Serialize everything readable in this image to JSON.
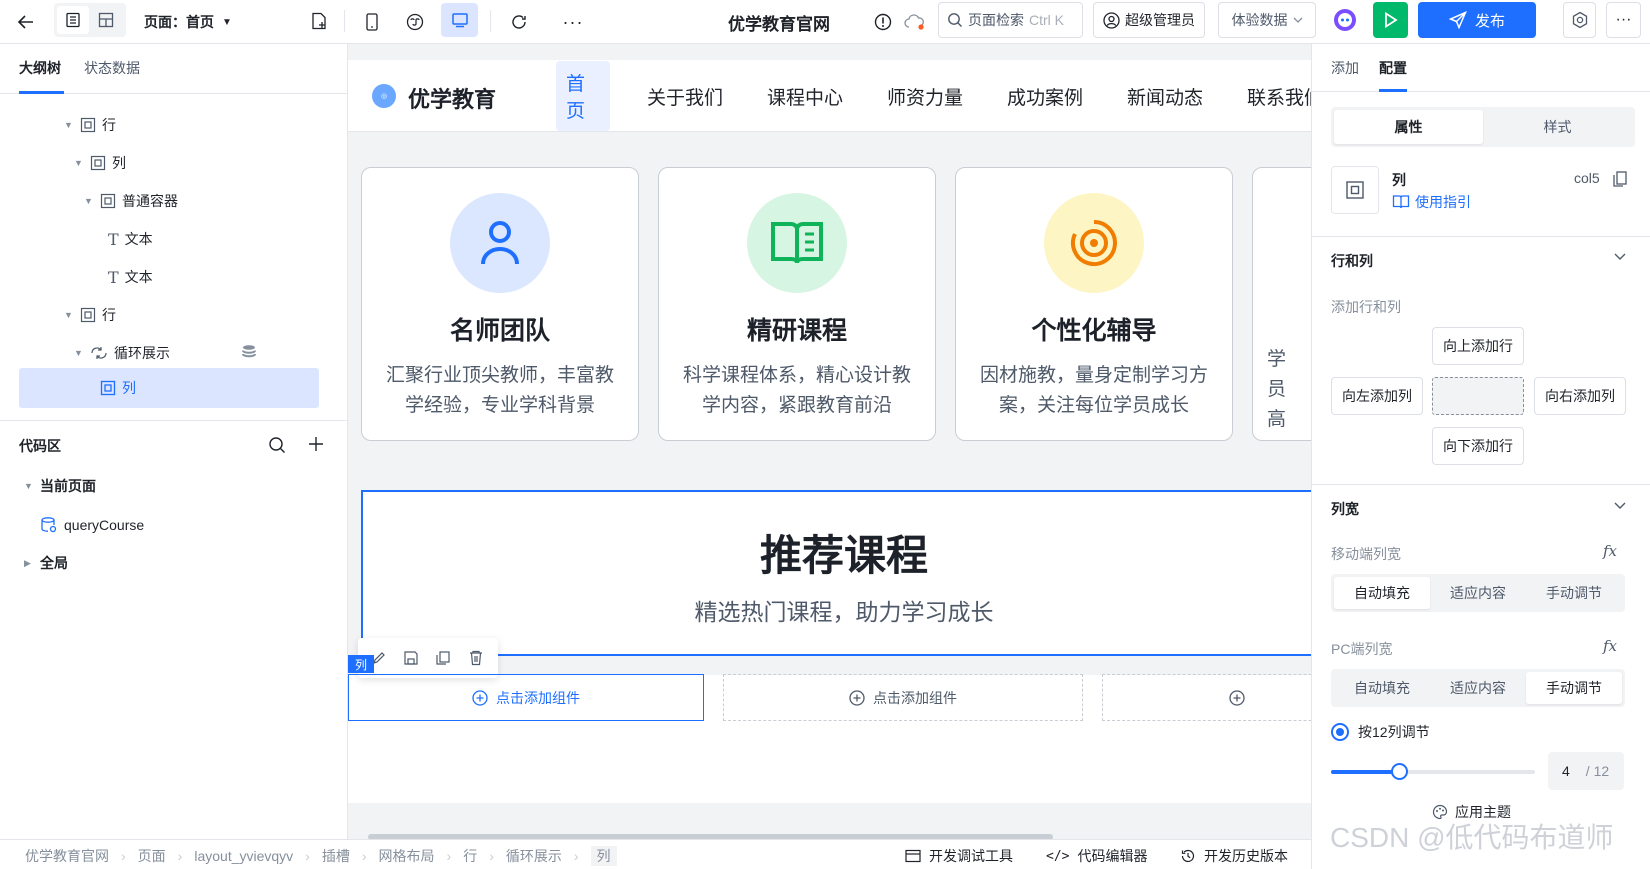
{
  "topbar": {
    "page_label": "页面：首页",
    "app_title": "优学教育官网",
    "search_placeholder": "页面检索",
    "search_shortcut": "Ctrl K",
    "user": "超级管理员",
    "data_select": "体验数据",
    "publish": "发布"
  },
  "left": {
    "tabs": [
      "大纲树",
      "状态数据"
    ],
    "tree": [
      "行",
      "列",
      "普通容器",
      "文本",
      "文本",
      "行",
      "循环展示",
      "列"
    ],
    "code_title": "代码区",
    "code_items": [
      "当前页面",
      "queryCourse",
      "全局"
    ]
  },
  "site": {
    "brand": "优学教育",
    "nav": [
      "首页",
      "关于我们",
      "课程中心",
      "师资力量",
      "成功案例",
      "新闻动态",
      "联系我们"
    ],
    "cards": [
      {
        "title": "名师团队",
        "desc": "汇聚行业顶尖教师，丰富教学经验，专业学科背景"
      },
      {
        "title": "精研课程",
        "desc": "科学课程体系，精心设计教学内容，紧跟教育前沿"
      },
      {
        "title": "个性化辅导",
        "desc": "因材施教，量身定制学习方案，关注每位学员成长"
      },
      {
        "title": "",
        "desc": "学员高"
      }
    ],
    "rec_title": "推荐课程",
    "rec_sub": "精选热门课程，助力学习成长",
    "col_tag": "列",
    "add_comp": "点击添加组件"
  },
  "right": {
    "tabs": [
      "添加",
      "配置"
    ],
    "seg1": [
      "属性",
      "样式"
    ],
    "comp_name": "列",
    "comp_id": "col5",
    "guide": "使用指引",
    "sec_rowcol": "行和列",
    "add_rowcol": "添加行和列",
    "btn_up": "向上添加行",
    "btn_left": "向左添加列",
    "btn_right": "向右添加列",
    "btn_down": "向下添加行",
    "sec_width": "列宽",
    "mobile_label": "移动端列宽",
    "pc_label": "PC端列宽",
    "width_opts": [
      "自动填充",
      "适应内容",
      "手动调节"
    ],
    "radio_label": "按12列调节",
    "slider_value": "4",
    "slider_total": "/ 12",
    "slider_fraction": 0.333
  },
  "bottom": {
    "crumbs": [
      "优学教育官网",
      "页面",
      "layout_yvievqyv",
      "插槽",
      "网格布局",
      "行",
      "循环展示",
      "列"
    ],
    "tools": [
      "开发调试工具",
      "代码编辑器",
      "开发历史版本"
    ],
    "theme": "应用主题",
    "watermark": "CSDN @低代码布道师"
  },
  "colors": {
    "primary": "#1e6fff",
    "selected_bg": "#dbe5ff",
    "run": "#00b96b"
  }
}
